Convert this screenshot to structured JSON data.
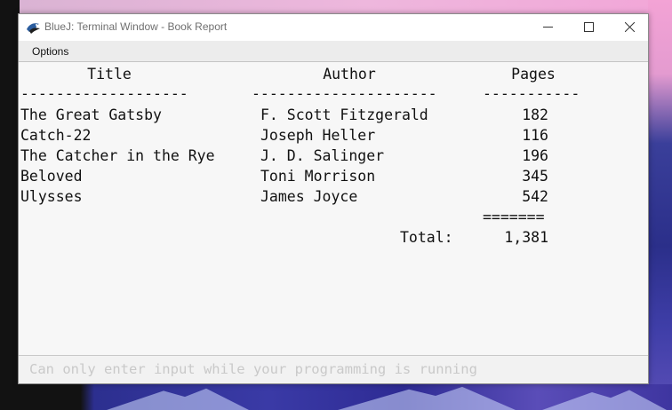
{
  "window": {
    "title": "BlueJ: Terminal Window - Book Report",
    "menu": {
      "options": "Options"
    }
  },
  "terminal": {
    "headers": {
      "title": "Title",
      "author": "Author",
      "pages": "Pages"
    },
    "separators": {
      "title": "-------------------",
      "author": "---------------------",
      "pages": "-----------"
    },
    "rows": [
      {
        "title": "The Great Gatsby",
        "author": "F. Scott Fitzgerald",
        "pages": "182"
      },
      {
        "title": "Catch-22",
        "author": "Joseph Heller",
        "pages": "116"
      },
      {
        "title": "The Catcher in the Rye",
        "author": "J. D. Salinger",
        "pages": "196"
      },
      {
        "title": "Beloved",
        "author": "Toni Morrison",
        "pages": "345"
      },
      {
        "title": "Ulysses",
        "author": "James Joyce",
        "pages": "542"
      }
    ],
    "total_rule": "=======",
    "total_label": "Total:",
    "total_value": "1,381"
  },
  "input": {
    "placeholder": "Can only enter input while your programming is running"
  }
}
